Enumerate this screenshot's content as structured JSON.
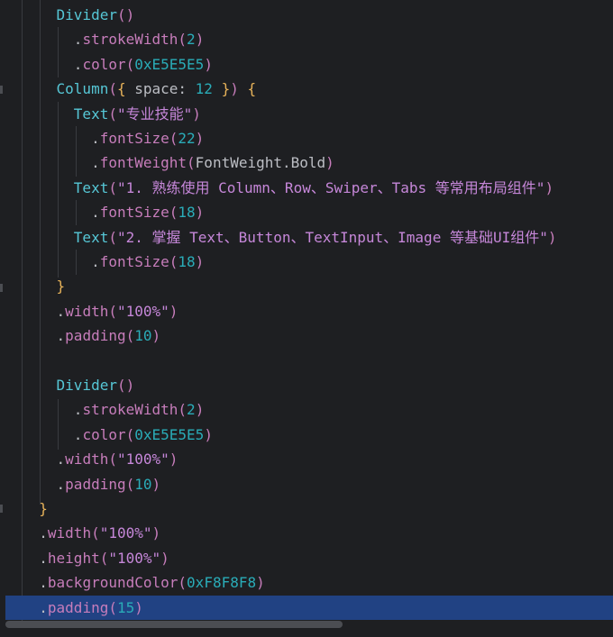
{
  "editor": {
    "lines": [
      {
        "indent": "    ",
        "tokens": [
          [
            "cls",
            "Divider"
          ],
          [
            "paren",
            "()"
          ]
        ]
      },
      {
        "indent": "      ",
        "tokens": [
          [
            "punc",
            "."
          ],
          [
            "prop",
            "strokeWidth"
          ],
          [
            "paren",
            "("
          ],
          [
            "num",
            "2"
          ],
          [
            "paren",
            ")"
          ]
        ]
      },
      {
        "indent": "      ",
        "tokens": [
          [
            "punc",
            "."
          ],
          [
            "prop",
            "color"
          ],
          [
            "paren",
            "("
          ],
          [
            "num",
            "0xE5E5E5"
          ],
          [
            "paren",
            ")"
          ]
        ]
      },
      {
        "indent": "    ",
        "tokens": [
          [
            "cls",
            "Column"
          ],
          [
            "paren",
            "("
          ],
          [
            "brace",
            "{"
          ],
          [
            "kw",
            " space: "
          ],
          [
            "num",
            "12"
          ],
          [
            "brace",
            " }"
          ],
          [
            "paren",
            ")"
          ],
          [
            "brace",
            " {"
          ]
        ]
      },
      {
        "indent": "      ",
        "tokens": [
          [
            "cls",
            "Text"
          ],
          [
            "paren",
            "("
          ],
          [
            "str2",
            "\"专业技能\""
          ],
          [
            "paren",
            ")"
          ]
        ]
      },
      {
        "indent": "        ",
        "tokens": [
          [
            "punc",
            "."
          ],
          [
            "prop",
            "fontSize"
          ],
          [
            "paren",
            "("
          ],
          [
            "num",
            "22"
          ],
          [
            "paren",
            ")"
          ]
        ]
      },
      {
        "indent": "        ",
        "tokens": [
          [
            "punc",
            "."
          ],
          [
            "prop",
            "fontWeight"
          ],
          [
            "paren",
            "("
          ],
          [
            "kw",
            "FontWeight.Bold"
          ],
          [
            "paren",
            ")"
          ]
        ]
      },
      {
        "indent": "      ",
        "tokens": [
          [
            "cls",
            "Text"
          ],
          [
            "paren",
            "("
          ],
          [
            "str2",
            "\"1. 熟练使用 Column、Row、Swiper、Tabs 等常用布局组件\""
          ],
          [
            "paren",
            ")"
          ]
        ]
      },
      {
        "indent": "        ",
        "tokens": [
          [
            "punc",
            "."
          ],
          [
            "prop",
            "fontSize"
          ],
          [
            "paren",
            "("
          ],
          [
            "num",
            "18"
          ],
          [
            "paren",
            ")"
          ]
        ]
      },
      {
        "indent": "      ",
        "tokens": [
          [
            "cls",
            "Text"
          ],
          [
            "paren",
            "("
          ],
          [
            "str2",
            "\"2. 掌握 Text、Button、TextInput、Image 等基础UI组件\""
          ],
          [
            "paren",
            ")"
          ]
        ]
      },
      {
        "indent": "        ",
        "tokens": [
          [
            "punc",
            "."
          ],
          [
            "prop",
            "fontSize"
          ],
          [
            "paren",
            "("
          ],
          [
            "num",
            "18"
          ],
          [
            "paren",
            ")"
          ]
        ]
      },
      {
        "indent": "    ",
        "tokens": [
          [
            "brace",
            "}"
          ]
        ]
      },
      {
        "indent": "    ",
        "tokens": [
          [
            "punc",
            "."
          ],
          [
            "prop",
            "width"
          ],
          [
            "paren",
            "("
          ],
          [
            "str2",
            "\"100%\""
          ],
          [
            "paren",
            ")"
          ]
        ]
      },
      {
        "indent": "    ",
        "tokens": [
          [
            "punc",
            "."
          ],
          [
            "prop",
            "padding"
          ],
          [
            "paren",
            "("
          ],
          [
            "num",
            "10"
          ],
          [
            "paren",
            ")"
          ]
        ]
      },
      {
        "indent": "",
        "tokens": []
      },
      {
        "indent": "    ",
        "tokens": [
          [
            "cls",
            "Divider"
          ],
          [
            "paren",
            "()"
          ]
        ]
      },
      {
        "indent": "      ",
        "tokens": [
          [
            "punc",
            "."
          ],
          [
            "prop",
            "strokeWidth"
          ],
          [
            "paren",
            "("
          ],
          [
            "num",
            "2"
          ],
          [
            "paren",
            ")"
          ]
        ]
      },
      {
        "indent": "      ",
        "tokens": [
          [
            "punc",
            "."
          ],
          [
            "prop",
            "color"
          ],
          [
            "paren",
            "("
          ],
          [
            "num",
            "0xE5E5E5"
          ],
          [
            "paren",
            ")"
          ]
        ]
      },
      {
        "indent": "    ",
        "tokens": [
          [
            "punc",
            "."
          ],
          [
            "prop",
            "width"
          ],
          [
            "paren",
            "("
          ],
          [
            "str2",
            "\"100%\""
          ],
          [
            "paren",
            ")"
          ]
        ]
      },
      {
        "indent": "    ",
        "tokens": [
          [
            "punc",
            "."
          ],
          [
            "prop",
            "padding"
          ],
          [
            "paren",
            "("
          ],
          [
            "num",
            "10"
          ],
          [
            "paren",
            ")"
          ]
        ]
      },
      {
        "indent": "  ",
        "tokens": [
          [
            "brace",
            "}"
          ]
        ]
      },
      {
        "indent": "  ",
        "tokens": [
          [
            "punc",
            "."
          ],
          [
            "prop",
            "width"
          ],
          [
            "paren",
            "("
          ],
          [
            "str2",
            "\"100%\""
          ],
          [
            "paren",
            ")"
          ]
        ]
      },
      {
        "indent": "  ",
        "tokens": [
          [
            "punc",
            "."
          ],
          [
            "prop",
            "height"
          ],
          [
            "paren",
            "("
          ],
          [
            "str2",
            "\"100%\""
          ],
          [
            "paren",
            ")"
          ]
        ]
      },
      {
        "indent": "  ",
        "tokens": [
          [
            "punc",
            "."
          ],
          [
            "prop",
            "backgroundColor"
          ],
          [
            "paren",
            "("
          ],
          [
            "num",
            "0xF8F8F8"
          ],
          [
            "paren",
            ")"
          ]
        ]
      },
      {
        "indent": "  ",
        "tokens": [
          [
            "punc",
            "."
          ],
          [
            "prop",
            "padding"
          ],
          [
            "paren",
            "("
          ],
          [
            "num",
            "15"
          ],
          [
            "paren",
            ")"
          ]
        ],
        "current": true
      }
    ]
  }
}
